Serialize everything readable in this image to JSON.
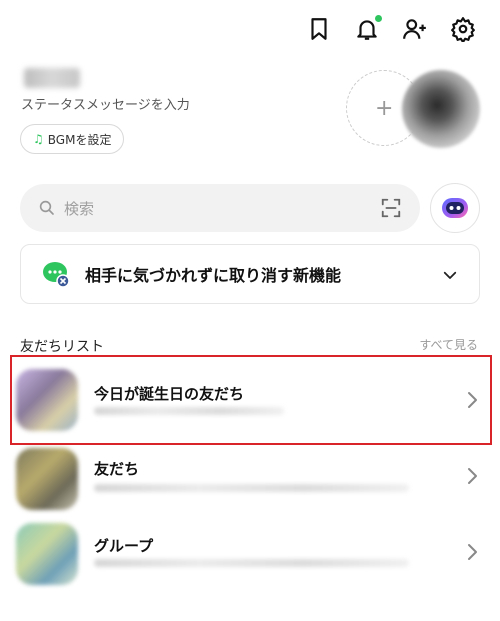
{
  "header": {
    "icons": [
      "bookmark-icon",
      "bell-icon",
      "add-friend-icon",
      "gear-icon"
    ],
    "notification_dot_color": "#2ec55f"
  },
  "profile": {
    "status_message": "ステータスメッセージを入力",
    "bgm_label": "BGMを設定",
    "add_icon": "+"
  },
  "search": {
    "placeholder": "検索"
  },
  "notice": {
    "text": "相手に気づかれずに取り消す新機能"
  },
  "friends_section": {
    "title": "友だちリスト",
    "see_all": "すべて見る",
    "rows": [
      {
        "label": "今日が誕生日の友だち"
      },
      {
        "label": "友だち"
      },
      {
        "label": "グループ"
      }
    ]
  },
  "colors": {
    "accent_green": "#2ec55f",
    "highlight_red": "#d9252a"
  }
}
